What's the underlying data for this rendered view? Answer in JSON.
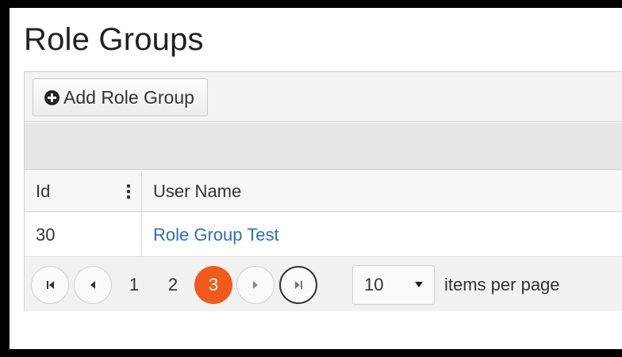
{
  "page": {
    "title": "Role Groups"
  },
  "toolbar": {
    "add_label": "Add Role Group"
  },
  "table": {
    "columns": [
      "Id",
      "User Name"
    ],
    "rows": [
      {
        "id": "30",
        "name": "Role Group Test"
      }
    ]
  },
  "pager": {
    "pages": [
      "1",
      "2",
      "3"
    ],
    "current_page": "3",
    "page_size": "10",
    "page_size_label": "items per page"
  },
  "colors": {
    "accent": "#f05a1a",
    "link": "#2f6fb5"
  },
  "icons": [
    "plus-circle-icon",
    "column-menu-icon",
    "first-page-icon",
    "prev-page-icon",
    "next-page-icon",
    "last-page-icon",
    "caret-down-icon"
  ]
}
